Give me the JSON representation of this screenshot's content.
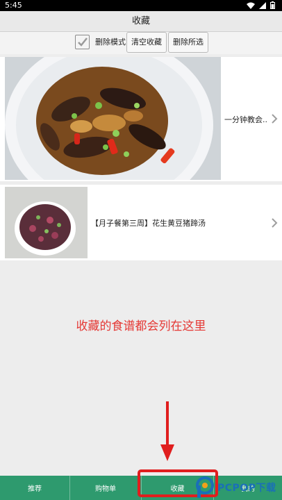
{
  "status_bar": {
    "time": "5:45"
  },
  "header": {
    "title": "收藏"
  },
  "toolbar": {
    "delete_mode_label": "删除模式",
    "delete_mode_checked": true,
    "clear_label": "清空收藏",
    "delete_selected_label": "删除所选"
  },
  "favorites": [
    {
      "title": "一分钟教会..."
    },
    {
      "title": "【月子餐第三周】花生黄豆猪蹄汤"
    }
  ],
  "hint": {
    "text": "收藏的食谱都会列在这里"
  },
  "bottom_nav": {
    "items": [
      {
        "label": "推荐"
      },
      {
        "label": "购物单"
      },
      {
        "label": "收藏"
      },
      {
        "label": "我的"
      }
    ],
    "active": "收藏"
  },
  "watermark": {
    "text": "PCPOP下载"
  },
  "colors": {
    "nav_bg": "#2e9a6e",
    "hint_red": "#e53935",
    "highlight_red": "#e01e1e"
  }
}
